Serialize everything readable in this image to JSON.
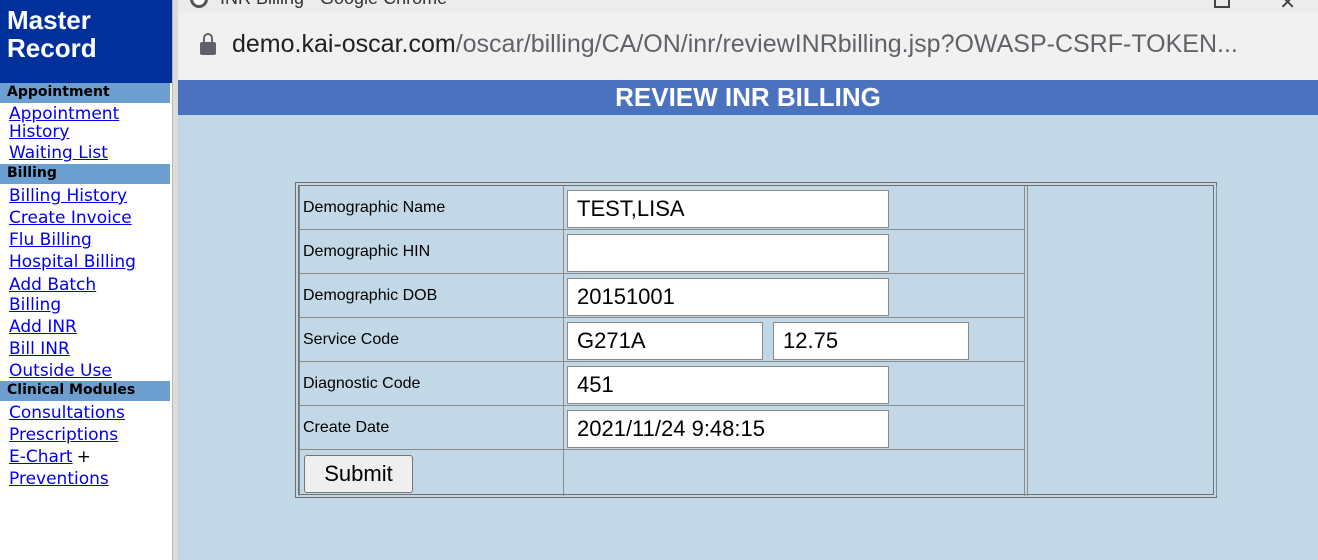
{
  "sidebar": {
    "title_line1": "Master",
    "title_line2": "Record",
    "sections": [
      {
        "header": "Appointment",
        "links": [
          "Appointment History",
          "Waiting List"
        ]
      },
      {
        "header": "Billing",
        "links": [
          "Billing History",
          "Create Invoice",
          "Flu Billing",
          "Hospital Billing",
          "Add Batch Billing",
          "Add INR",
          "Bill INR",
          "Outside Use"
        ]
      },
      {
        "header": "Clinical Modules",
        "links": [
          "Consultations",
          "Prescriptions",
          "E-Chart",
          "Preventions"
        ]
      }
    ],
    "echart_plus": "+"
  },
  "browser": {
    "window_title": "INR Billing - Google Chrome",
    "url_host": "demo.kai-oscar.com",
    "url_path": "/oscar/billing/CA/ON/inr/reviewINRbilling.jsp?OWASP-CSRF-TOKEN..."
  },
  "page": {
    "header": "REVIEW INR BILLING"
  },
  "form": {
    "demographic_name_label": "Demographic Name",
    "demographic_name_value": "TEST,LISA",
    "demographic_hin_label": "Demographic HIN",
    "demographic_hin_value": "",
    "demographic_dob_label": "Demographic DOB",
    "demographic_dob_value": "20151001",
    "service_code_label": "Service Code",
    "service_code_value": "G271A",
    "service_fee_value": "12.75",
    "diagnostic_code_label": "Diagnostic Code",
    "diagnostic_code_value": "451",
    "create_date_label": "Create Date",
    "create_date_value": "2021/11/24 9:48:15",
    "submit_label": "Submit"
  },
  "colors": {
    "sidebar_title_bg": "#00309c",
    "sidebar_section_bg": "#6d9ed0",
    "page_header_bg": "#4a72be",
    "page_bg": "#c3d8e6",
    "link": "#0000ee"
  }
}
